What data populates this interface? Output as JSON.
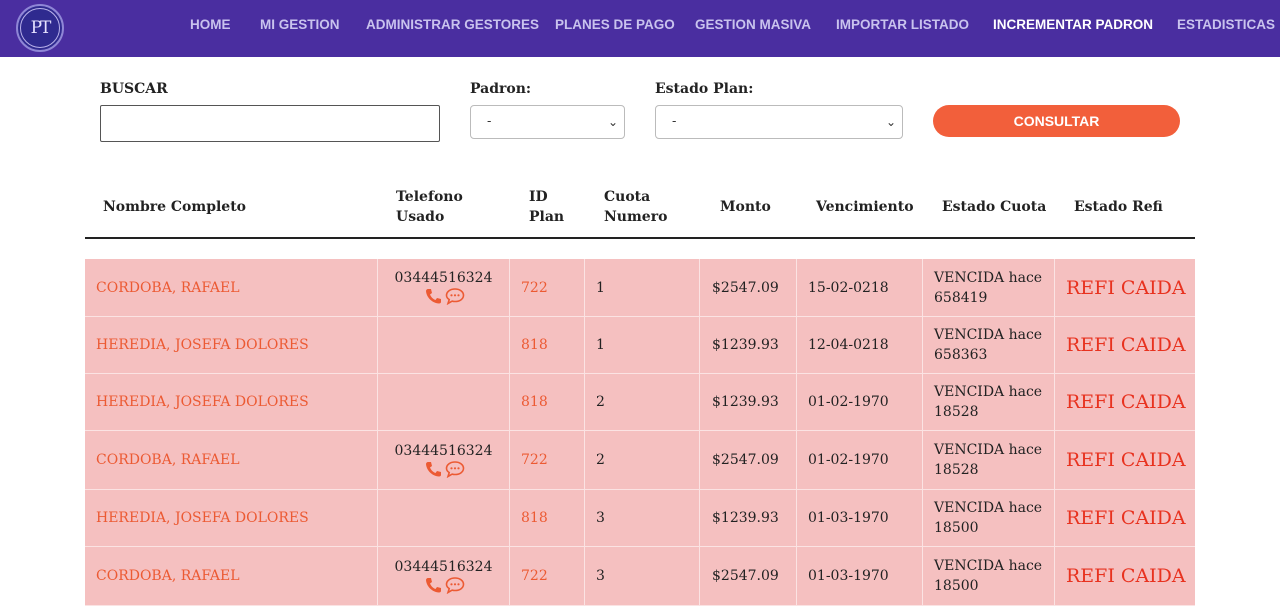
{
  "nav": {
    "logo_text": "PT",
    "items": [
      {
        "label": "HOME"
      },
      {
        "label": "MI GESTION"
      },
      {
        "label": "ADMINISTRAR GESTORES"
      },
      {
        "label": "PLANES DE PAGO"
      },
      {
        "label": "GESTION MASIVA"
      },
      {
        "label": "IMPORTAR LISTADO"
      },
      {
        "label": "INCREMENTAR PADRON"
      },
      {
        "label": "ESTADISTICAS"
      }
    ],
    "active_item": "INCREMENTAR PADRON"
  },
  "filters": {
    "search_label": "BUSCAR",
    "search_value": "",
    "padron_label": "Padron:",
    "padron_selected": "-",
    "estado_label": "Estado Plan:",
    "estado_selected": "-",
    "consultar_label": "CONSULTAR"
  },
  "table": {
    "headers": {
      "nombre": "Nombre Completo",
      "telefono_1": "Telefono",
      "telefono_2": "Usado",
      "id_1": "ID",
      "id_2": "Plan",
      "cuota_1": "Cuota",
      "cuota_2": "Numero",
      "monto": "Monto",
      "vencimiento": "Vencimiento",
      "estado_cuota": "Estado Cuota",
      "estado_refi": "Estado Refi"
    },
    "rows": [
      {
        "nombre": "CORDOBA, RAFAEL",
        "telefono": "03444516324",
        "id_plan": "722",
        "cuota": "1",
        "monto": "$2547.09",
        "vencimiento": "15-02-0218",
        "estado_1": "VENCIDA hace",
        "estado_2": "658419",
        "refi": "REFI CAIDA"
      },
      {
        "nombre": "HEREDIA, JOSEFA DOLORES",
        "telefono": "",
        "id_plan": "818",
        "cuota": "1",
        "monto": "$1239.93",
        "vencimiento": "12-04-0218",
        "estado_1": "VENCIDA hace",
        "estado_2": "658363",
        "refi": "REFI CAIDA"
      },
      {
        "nombre": "HEREDIA, JOSEFA DOLORES",
        "telefono": "",
        "id_plan": "818",
        "cuota": "2",
        "monto": "$1239.93",
        "vencimiento": "01-02-1970",
        "estado_1": "VENCIDA hace",
        "estado_2": "18528",
        "refi": "REFI CAIDA"
      },
      {
        "nombre": "CORDOBA, RAFAEL",
        "telefono": "03444516324",
        "id_plan": "722",
        "cuota": "2",
        "monto": "$2547.09",
        "vencimiento": "01-02-1970",
        "estado_1": "VENCIDA hace",
        "estado_2": "18528",
        "refi": "REFI CAIDA"
      },
      {
        "nombre": "HEREDIA, JOSEFA DOLORES",
        "telefono": "",
        "id_plan": "818",
        "cuota": "3",
        "monto": "$1239.93",
        "vencimiento": "01-03-1970",
        "estado_1": "VENCIDA hace",
        "estado_2": "18500",
        "refi": "REFI CAIDA"
      },
      {
        "nombre": "CORDOBA, RAFAEL",
        "telefono": "03444516324",
        "id_plan": "722",
        "cuota": "3",
        "monto": "$2547.09",
        "vencimiento": "01-03-1970",
        "estado_1": "VENCIDA hace",
        "estado_2": "18500",
        "refi": "REFI CAIDA"
      }
    ]
  },
  "colors": {
    "navbar": "#4a2ea0",
    "accent": "#f25f3b",
    "row_bg": "#f5c0c0",
    "refi_text": "#e8321f"
  },
  "icons": {
    "phone": "phone-icon",
    "chat": "chat-icon",
    "select_arrow": "chevron-down-icon"
  }
}
